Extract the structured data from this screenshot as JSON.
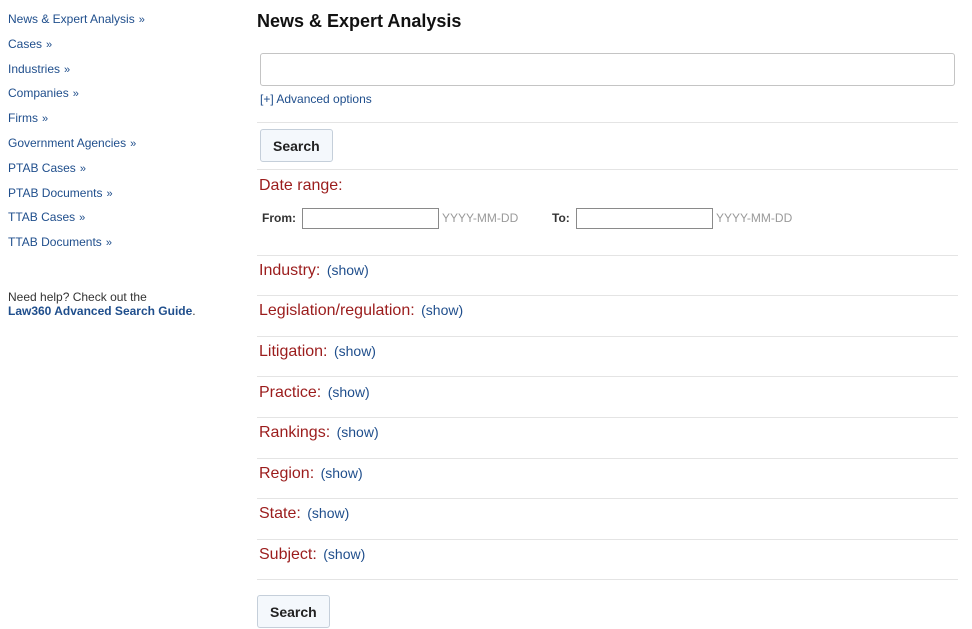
{
  "sidebar": {
    "items": [
      {
        "label": "News & Expert Analysis",
        "arrow": "»"
      },
      {
        "label": "Cases",
        "arrow": "»"
      },
      {
        "label": "Industries",
        "arrow": "»"
      },
      {
        "label": "Companies",
        "arrow": "»"
      },
      {
        "label": "Firms",
        "arrow": "»"
      },
      {
        "label": "Government Agencies",
        "arrow": "»"
      },
      {
        "label": "PTAB Cases",
        "arrow": "»"
      },
      {
        "label": "PTAB Documents",
        "arrow": "»"
      },
      {
        "label": "TTAB Cases",
        "arrow": "»"
      },
      {
        "label": "TTAB Documents",
        "arrow": "»"
      }
    ],
    "help_text": "Need help? Check out the",
    "help_link": "Law360 Advanced Search Guide",
    "help_period": "."
  },
  "main": {
    "title": "News & Expert Analysis",
    "query_value": "",
    "advanced_options": "[+] Advanced options",
    "search_label": "Search",
    "search_label_bottom": "Search",
    "date_range": {
      "label": "Date range:",
      "from_label": "From:",
      "from_value": "",
      "from_hint": "YYYY-MM-DD",
      "to_label": "To:",
      "to_value": "",
      "to_hint": "YYYY-MM-DD"
    },
    "facets": [
      {
        "label": "Industry:",
        "show": "(show)"
      },
      {
        "label": "Legislation/regulation:",
        "show": "(show)"
      },
      {
        "label": "Litigation:",
        "show": "(show)"
      },
      {
        "label": "Practice:",
        "show": "(show)"
      },
      {
        "label": "Rankings:",
        "show": "(show)"
      },
      {
        "label": "Region:",
        "show": "(show)"
      },
      {
        "label": "State:",
        "show": "(show)"
      },
      {
        "label": "Subject:",
        "show": "(show)"
      }
    ]
  },
  "colors": {
    "link": "#1f4e8c",
    "facet_label": "#9b1c1c"
  }
}
